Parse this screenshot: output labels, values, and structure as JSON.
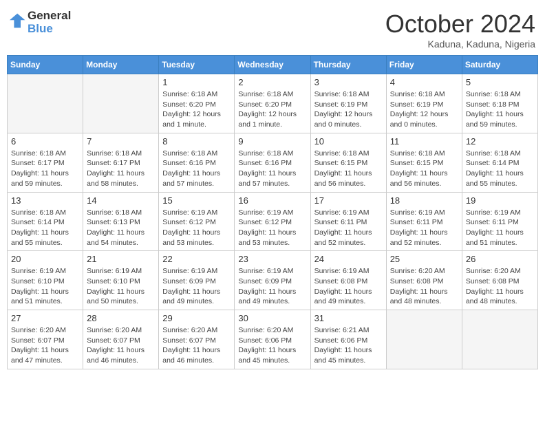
{
  "header": {
    "logo_general": "General",
    "logo_blue": "Blue",
    "month_title": "October 2024",
    "subtitle": "Kaduna, Kaduna, Nigeria"
  },
  "days_of_week": [
    "Sunday",
    "Monday",
    "Tuesday",
    "Wednesday",
    "Thursday",
    "Friday",
    "Saturday"
  ],
  "weeks": [
    [
      {
        "day": "",
        "info": ""
      },
      {
        "day": "",
        "info": ""
      },
      {
        "day": "1",
        "info": "Sunrise: 6:18 AM\nSunset: 6:20 PM\nDaylight: 12 hours and 1 minute."
      },
      {
        "day": "2",
        "info": "Sunrise: 6:18 AM\nSunset: 6:20 PM\nDaylight: 12 hours and 1 minute."
      },
      {
        "day": "3",
        "info": "Sunrise: 6:18 AM\nSunset: 6:19 PM\nDaylight: 12 hours and 0 minutes."
      },
      {
        "day": "4",
        "info": "Sunrise: 6:18 AM\nSunset: 6:19 PM\nDaylight: 12 hours and 0 minutes."
      },
      {
        "day": "5",
        "info": "Sunrise: 6:18 AM\nSunset: 6:18 PM\nDaylight: 11 hours and 59 minutes."
      }
    ],
    [
      {
        "day": "6",
        "info": "Sunrise: 6:18 AM\nSunset: 6:17 PM\nDaylight: 11 hours and 59 minutes."
      },
      {
        "day": "7",
        "info": "Sunrise: 6:18 AM\nSunset: 6:17 PM\nDaylight: 11 hours and 58 minutes."
      },
      {
        "day": "8",
        "info": "Sunrise: 6:18 AM\nSunset: 6:16 PM\nDaylight: 11 hours and 57 minutes."
      },
      {
        "day": "9",
        "info": "Sunrise: 6:18 AM\nSunset: 6:16 PM\nDaylight: 11 hours and 57 minutes."
      },
      {
        "day": "10",
        "info": "Sunrise: 6:18 AM\nSunset: 6:15 PM\nDaylight: 11 hours and 56 minutes."
      },
      {
        "day": "11",
        "info": "Sunrise: 6:18 AM\nSunset: 6:15 PM\nDaylight: 11 hours and 56 minutes."
      },
      {
        "day": "12",
        "info": "Sunrise: 6:18 AM\nSunset: 6:14 PM\nDaylight: 11 hours and 55 minutes."
      }
    ],
    [
      {
        "day": "13",
        "info": "Sunrise: 6:18 AM\nSunset: 6:14 PM\nDaylight: 11 hours and 55 minutes."
      },
      {
        "day": "14",
        "info": "Sunrise: 6:18 AM\nSunset: 6:13 PM\nDaylight: 11 hours and 54 minutes."
      },
      {
        "day": "15",
        "info": "Sunrise: 6:19 AM\nSunset: 6:12 PM\nDaylight: 11 hours and 53 minutes."
      },
      {
        "day": "16",
        "info": "Sunrise: 6:19 AM\nSunset: 6:12 PM\nDaylight: 11 hours and 53 minutes."
      },
      {
        "day": "17",
        "info": "Sunrise: 6:19 AM\nSunset: 6:11 PM\nDaylight: 11 hours and 52 minutes."
      },
      {
        "day": "18",
        "info": "Sunrise: 6:19 AM\nSunset: 6:11 PM\nDaylight: 11 hours and 52 minutes."
      },
      {
        "day": "19",
        "info": "Sunrise: 6:19 AM\nSunset: 6:11 PM\nDaylight: 11 hours and 51 minutes."
      }
    ],
    [
      {
        "day": "20",
        "info": "Sunrise: 6:19 AM\nSunset: 6:10 PM\nDaylight: 11 hours and 51 minutes."
      },
      {
        "day": "21",
        "info": "Sunrise: 6:19 AM\nSunset: 6:10 PM\nDaylight: 11 hours and 50 minutes."
      },
      {
        "day": "22",
        "info": "Sunrise: 6:19 AM\nSunset: 6:09 PM\nDaylight: 11 hours and 49 minutes."
      },
      {
        "day": "23",
        "info": "Sunrise: 6:19 AM\nSunset: 6:09 PM\nDaylight: 11 hours and 49 minutes."
      },
      {
        "day": "24",
        "info": "Sunrise: 6:19 AM\nSunset: 6:08 PM\nDaylight: 11 hours and 49 minutes."
      },
      {
        "day": "25",
        "info": "Sunrise: 6:20 AM\nSunset: 6:08 PM\nDaylight: 11 hours and 48 minutes."
      },
      {
        "day": "26",
        "info": "Sunrise: 6:20 AM\nSunset: 6:08 PM\nDaylight: 11 hours and 48 minutes."
      }
    ],
    [
      {
        "day": "27",
        "info": "Sunrise: 6:20 AM\nSunset: 6:07 PM\nDaylight: 11 hours and 47 minutes."
      },
      {
        "day": "28",
        "info": "Sunrise: 6:20 AM\nSunset: 6:07 PM\nDaylight: 11 hours and 46 minutes."
      },
      {
        "day": "29",
        "info": "Sunrise: 6:20 AM\nSunset: 6:07 PM\nDaylight: 11 hours and 46 minutes."
      },
      {
        "day": "30",
        "info": "Sunrise: 6:20 AM\nSunset: 6:06 PM\nDaylight: 11 hours and 45 minutes."
      },
      {
        "day": "31",
        "info": "Sunrise: 6:21 AM\nSunset: 6:06 PM\nDaylight: 11 hours and 45 minutes."
      },
      {
        "day": "",
        "info": ""
      },
      {
        "day": "",
        "info": ""
      }
    ]
  ]
}
